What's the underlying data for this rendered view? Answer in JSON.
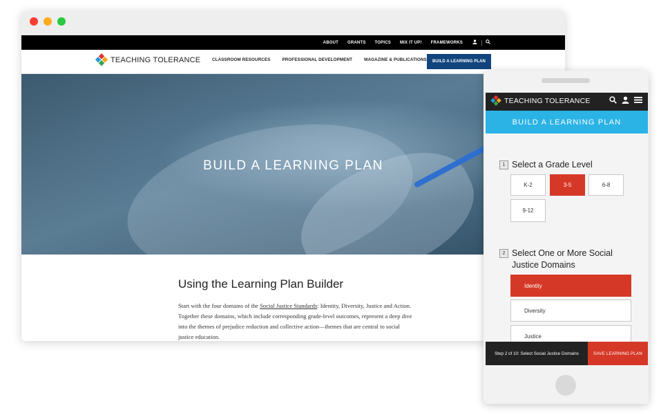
{
  "desktop": {
    "utility_nav": [
      "ABOUT",
      "GRANTS",
      "TOPICS",
      "MIX IT UP!",
      "FRAMEWORKS"
    ],
    "logo_text": "TEACHING TOLERANCE",
    "main_nav": [
      "CLASSROOM RESOURCES",
      "PROFESSIONAL DEVELOPMENT",
      "MAGAZINE & PUBLICATIONS"
    ],
    "build_button": "BUILD A LEARNING PLAN",
    "hero_title": "BUILD A LEARNING PLAN",
    "content": {
      "heading": "Using the Learning Plan Builder",
      "intro_before": "Start with the four domains of the ",
      "intro_link": "Social Justice Standards",
      "intro_after": ": Identity, Diversity, Justice and Action. Together these domains, which include corresponding grade-level outcomes, represent a deep dive into the themes of prejudice reduction and collective action—themes that are central to social justice education."
    }
  },
  "mobile": {
    "logo_text": "TEACHING TOLERANCE",
    "banner": "BUILD A LEARNING PLAN",
    "step1": {
      "number": "1",
      "title": "Select a Grade Level"
    },
    "grades": [
      {
        "label": "K-2",
        "selected": false
      },
      {
        "label": "3-5",
        "selected": true
      },
      {
        "label": "6-8",
        "selected": false
      },
      {
        "label": "9-12",
        "selected": false
      }
    ],
    "step2": {
      "number": "2",
      "title": "Select One or More Social Justice Domains"
    },
    "domains": [
      {
        "label": "Identity",
        "selected": true
      },
      {
        "label": "Diversity",
        "selected": false
      },
      {
        "label": "Justice",
        "selected": false
      }
    ],
    "footer_status": "Step 2 of 10: Select Social Justice Domains",
    "footer_save": "SAVE LEARNING PLAN"
  },
  "colors": {
    "brand_navy": "#12457e",
    "banner_cyan": "#2bb3e5",
    "selected_red": "#d63827"
  }
}
